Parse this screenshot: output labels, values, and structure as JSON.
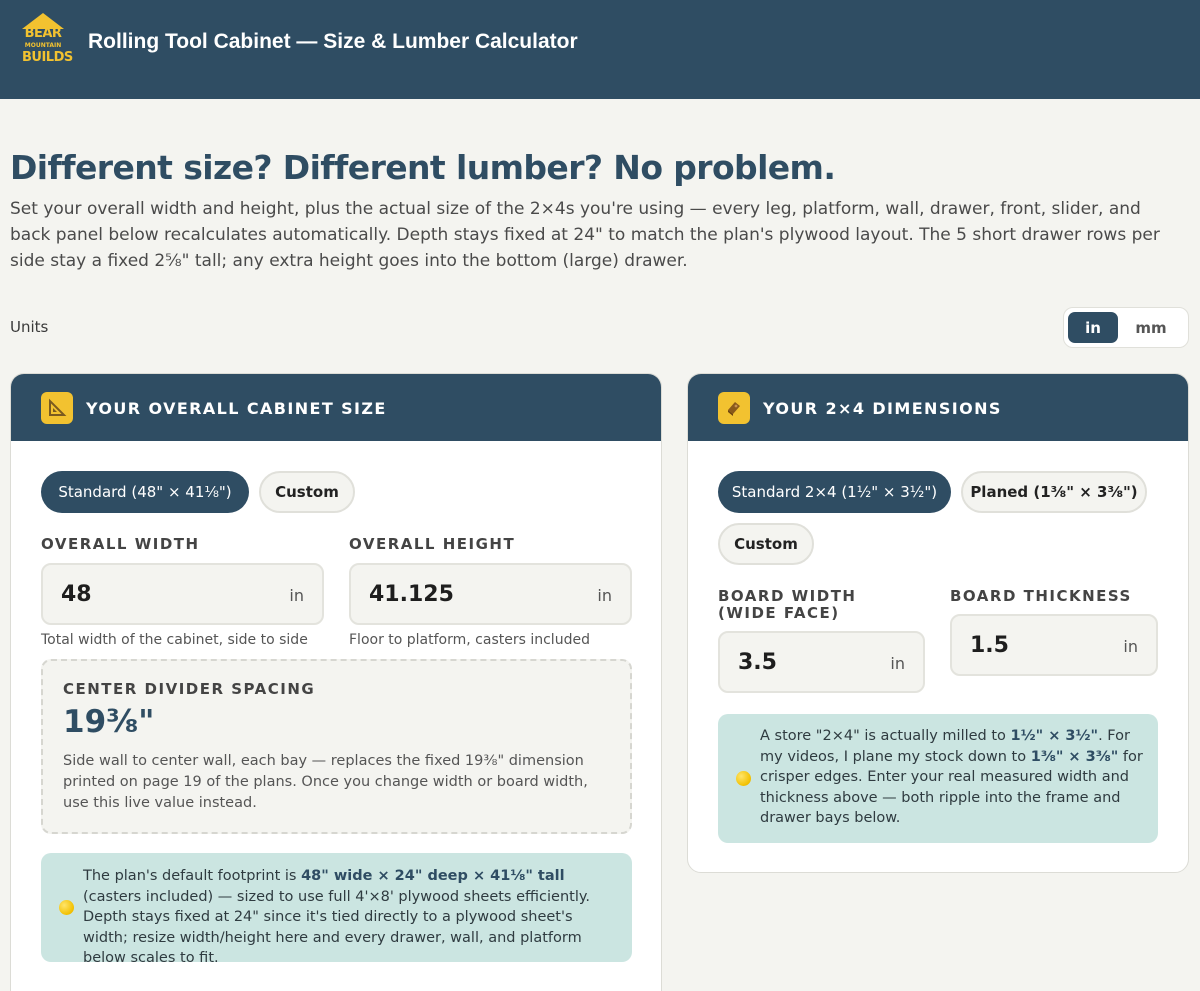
{
  "header": {
    "logo_text": [
      "BEAR",
      "MOUNTAIN",
      "BUILDS"
    ],
    "title": "Rolling Tool Cabinet — Size & Lumber Calculator"
  },
  "intro": {
    "headline": "Different size? Different lumber? No problem.",
    "body": "Set your overall width and height, plus the actual size of the 2×4s you're using — every leg, platform, wall, drawer, front, slider, and back panel below recalculates automatically. Depth stays fixed at 24\" to match the plan's plywood layout. The 5 short drawer rows per side stay a fixed 2⅝\" tall; any extra height goes into the bottom (large) drawer."
  },
  "units": {
    "label": "Units",
    "options": [
      "in",
      "mm"
    ],
    "selected": "in"
  },
  "size_card": {
    "icon": "triangle-ruler-icon",
    "title": "YOUR OVERALL CABINET SIZE",
    "presets": [
      "Standard (48\" × 41⅛\")",
      "Custom"
    ],
    "selected_preset": "Standard (48\" × 41⅛\")",
    "width": {
      "label": "OVERALL WIDTH",
      "value": "48",
      "unit": "in",
      "hint": "Total width of the cabinet, side to side"
    },
    "height": {
      "label": "OVERALL HEIGHT",
      "value": "41.125",
      "unit": "in",
      "hint": "Floor to platform, casters included"
    },
    "divider": {
      "label": "CENTER DIVIDER SPACING",
      "value": "19⅜\"",
      "note": "Side wall to center wall, each bay — replaces the fixed 19⅜\" dimension printed on page 19 of the plans. Once you change width or board width, use this live value instead."
    },
    "tip": {
      "icon": "lightbulb-icon",
      "before": "The plan's default footprint is ",
      "bold": "48\" wide × 24\" deep × 41⅛\" tall",
      "after": " (casters included) — sized to use full 4'×8' plywood sheets efficiently. Depth stays fixed at 24\" since it's tied directly to a plywood sheet's width; resize width/height here and every drawer, wall, and platform below scales to fit."
    }
  },
  "lumber_card": {
    "icon": "lumber-icon",
    "title": "YOUR 2×4 DIMENSIONS",
    "presets": [
      "Standard 2×4 (1½\" × 3½\")",
      "Planed (1⅜\" × 3⅜\")",
      "Custom"
    ],
    "selected_preset": "Standard 2×4 (1½\" × 3½\")",
    "board_width": {
      "label": "BOARD WIDTH (WIDE FACE)",
      "value": "3.5",
      "unit": "in"
    },
    "board_thickness": {
      "label": "BOARD THICKNESS",
      "value": "1.5",
      "unit": "in"
    },
    "tip": {
      "icon": "lightbulb-icon",
      "t1": "A store \"2×4\" is actually milled to ",
      "b1": "1½\" × 3½\"",
      "t2": ". For my videos, I plane my stock down to ",
      "b2": "1⅜\" × 3⅜\"",
      "t3": " for crisper edges. Enter your real measured width and thickness above — both ripple into the frame and drawer bays below."
    }
  },
  "colors": {
    "header_bg": "#2f4d63",
    "accent": "#f2c230",
    "page_bg": "#f4f4f0",
    "tip_bg": "#cbe5e1"
  }
}
